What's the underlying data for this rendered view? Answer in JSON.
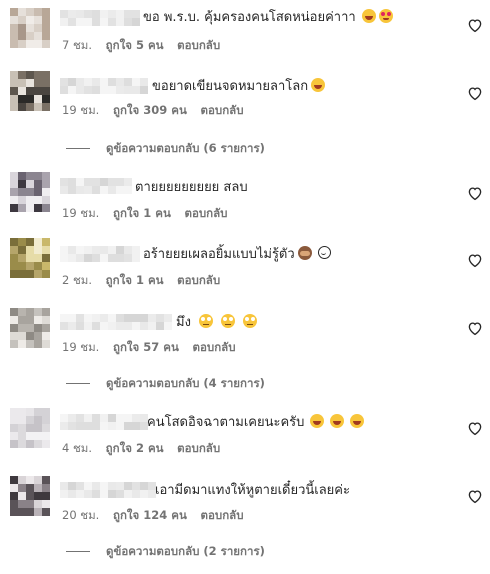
{
  "comments": [
    {
      "text": "ขอ พ.ร.บ. คุ้มครองคนโสดหน่อยค่าาา",
      "emojis": [
        "laugh-emoji",
        "heart-eyes-emoji"
      ],
      "time": "7 ชม.",
      "likes": "ถูกใจ 5 คน",
      "reply": "ตอบกลับ",
      "view_replies": ""
    },
    {
      "text": "ขอยาดเขียนจดหมายลาโลก",
      "emojis": [
        "laugh-emoji"
      ],
      "time": "19 ชม.",
      "likes": "ถูกใจ 309 คน",
      "reply": "ตอบกลับ",
      "view_replies": "ดูข้อความตอบกลับ (6 รายการ)"
    },
    {
      "text": "ตายยยยยยยยย สลบ",
      "emojis": [],
      "time": "19 ชม.",
      "likes": "ถูกใจ 1 คน",
      "reply": "ตอบกลับ",
      "view_replies": ""
    },
    {
      "text": "อร้ายยยเผลอยิ้มแบบไม่รู้ตัว",
      "emojis": [
        "see-no-evil-monkey-emoji",
        "smile-emoji"
      ],
      "time": "2 ชม.",
      "likes": "ถูกใจ 1 คน",
      "reply": "ตอบกลับ",
      "view_replies": ""
    },
    {
      "text": "มึง",
      "emojis": [
        "eye-roll-emoji",
        "eye-roll-emoji",
        "eye-roll-emoji"
      ],
      "time": "19 ชม.",
      "likes": "ถูกใจ 57 คน",
      "reply": "ตอบกลับ",
      "view_replies": "ดูข้อความตอบกลับ (4 รายการ)"
    },
    {
      "text": "คนโสดอิจฉาตามเคยนะครับ",
      "emojis": [
        "laugh-emoji",
        "laugh-emoji",
        "laugh-emoji"
      ],
      "time": "4 ชม.",
      "likes": "ถูกใจ 2 คน",
      "reply": "ตอบกลับ",
      "view_replies": ""
    },
    {
      "text": "เอามีดมาแทงให้หูตายเดี๋ยวนี้เลยค่ะ",
      "emojis": [],
      "time": "20 ชม.",
      "likes": "ถูกใจ 124 คน",
      "reply": "ตอบกลับ",
      "view_replies": "ดูข้อความตอบกลับ (2 รายการ)"
    }
  ],
  "icons": {
    "like": "heart-outline-icon",
    "avatar": "blurred-avatar",
    "username": "blurred-username"
  }
}
